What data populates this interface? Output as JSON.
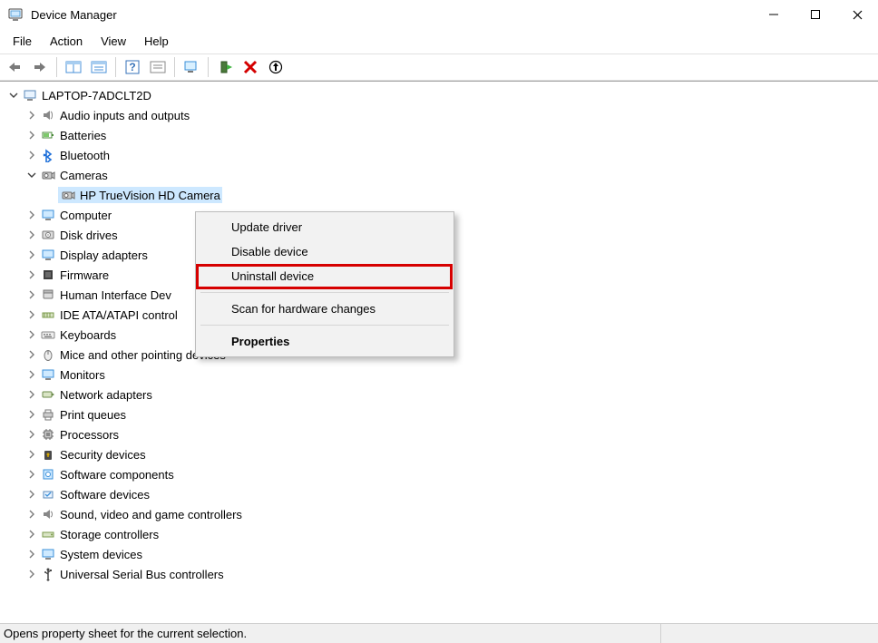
{
  "window": {
    "title": "Device Manager"
  },
  "menus": {
    "file": "File",
    "action": "Action",
    "view": "View",
    "help": "Help"
  },
  "tree": {
    "root": "LAPTOP-7ADCLT2D",
    "items": [
      "Audio inputs and outputs",
      "Batteries",
      "Bluetooth",
      "Cameras",
      "Computer",
      "Disk drives",
      "Display adapters",
      "Firmware",
      "Human Interface Dev",
      "IDE ATA/ATAPI control",
      "Keyboards",
      "Mice and other pointing devices",
      "Monitors",
      "Network adapters",
      "Print queues",
      "Processors",
      "Security devices",
      "Software components",
      "Software devices",
      "Sound, video and game controllers",
      "Storage controllers",
      "System devices",
      "Universal Serial Bus controllers"
    ],
    "camera_child": "HP TrueVision HD Camera"
  },
  "context_menu": {
    "update": "Update driver",
    "disable": "Disable device",
    "uninstall": "Uninstall device",
    "scan": "Scan for hardware changes",
    "properties": "Properties"
  },
  "statusbar": {
    "text": "Opens property sheet for the current selection."
  }
}
